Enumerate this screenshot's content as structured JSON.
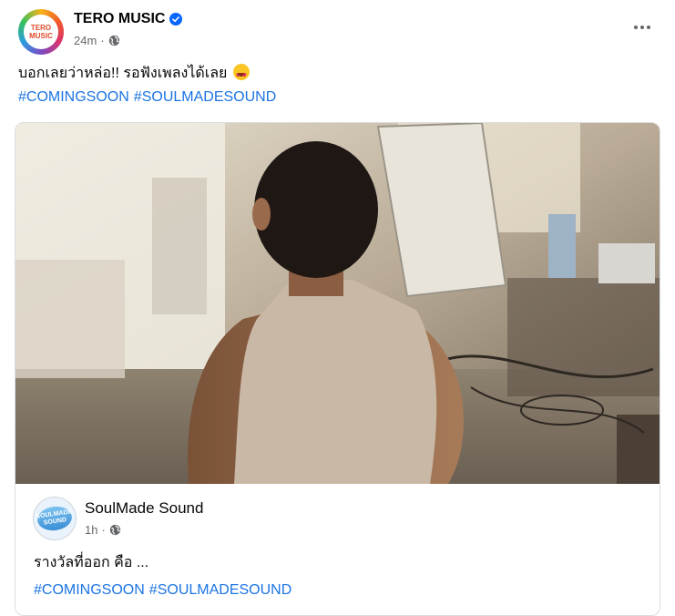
{
  "post": {
    "page_name": "TERO MUSIC",
    "avatar_text": "TERO MUSIC",
    "timestamp": "24m",
    "separator": "·",
    "audience_icon": "globe-icon",
    "verified_icon": "verified-badge-icon",
    "more_icon": "more-options-icon",
    "caption": "บอกเลยว่าหล่อ!! รอฟังเพลงได้เลย",
    "caption_emoji": "heart-eyes-emoji",
    "hashtags": [
      "#COMINGSOON",
      "#SOULMADESOUND"
    ]
  },
  "shared": {
    "page_name": "SoulMade Sound",
    "avatar_text": "SOULMADE SOUND",
    "timestamp": "1h",
    "separator": "·",
    "audience_icon": "globe-icon",
    "text": "รางวัลที่ออก คือ ...",
    "hashtags": [
      "#COMINGSOON",
      "#SOULMADESOUND"
    ]
  },
  "colors": {
    "link": "#1b74e4",
    "secondary_text": "#65676b",
    "verified": "#0866ff",
    "border": "#dadde1"
  }
}
